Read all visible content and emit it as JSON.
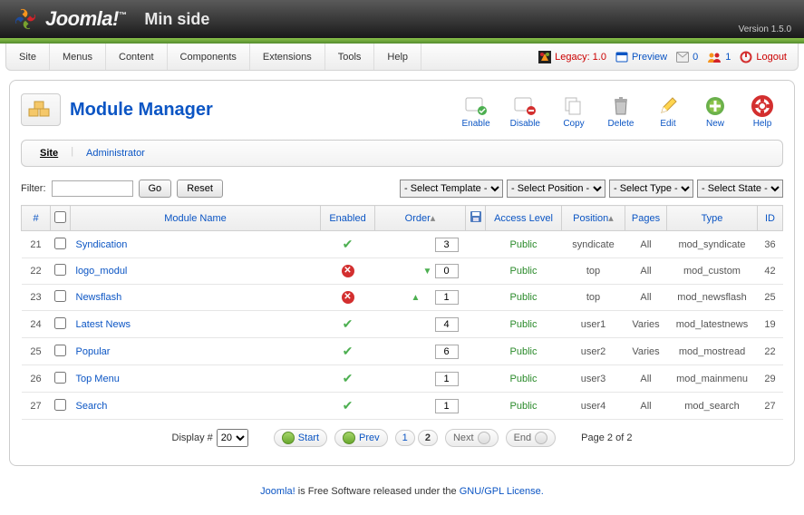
{
  "header": {
    "brand": "Joomla!",
    "site_name": "Min side",
    "version": "Version 1.5.0"
  },
  "menubar": {
    "items": [
      "Site",
      "Menus",
      "Content",
      "Components",
      "Extensions",
      "Tools",
      "Help"
    ],
    "legacy_label": "Legacy: 1.0",
    "preview_label": "Preview",
    "msg_count": "0",
    "users_count": "1",
    "logout_label": "Logout"
  },
  "page": {
    "title": "Module Manager",
    "submenu": {
      "site": "Site",
      "admin": "Administrator"
    }
  },
  "toolbar": {
    "enable": "Enable",
    "disable": "Disable",
    "copy": "Copy",
    "delete": "Delete",
    "edit": "Edit",
    "new": "New",
    "help": "Help"
  },
  "filter": {
    "label": "Filter:",
    "value": "",
    "go": "Go",
    "reset": "Reset",
    "selects": {
      "template": "- Select Template -",
      "position": "- Select Position -",
      "type": "- Select Type -",
      "state": "- Select State -"
    }
  },
  "columns": {
    "num": "#",
    "name": "Module Name",
    "enabled": "Enabled",
    "order": "Order",
    "access": "Access Level",
    "position": "Position",
    "pages": "Pages",
    "type": "Type",
    "id": "ID"
  },
  "rows": [
    {
      "num": "21",
      "name": "Syndication",
      "enabled": true,
      "up": false,
      "down": false,
      "order": "3",
      "access": "Public",
      "position": "syndicate",
      "pages": "All",
      "type": "mod_syndicate",
      "id": "36"
    },
    {
      "num": "22",
      "name": "logo_modul",
      "enabled": false,
      "up": false,
      "down": true,
      "order": "0",
      "access": "Public",
      "position": "top",
      "pages": "All",
      "type": "mod_custom",
      "id": "42"
    },
    {
      "num": "23",
      "name": "Newsflash",
      "enabled": false,
      "up": true,
      "down": false,
      "order": "1",
      "access": "Public",
      "position": "top",
      "pages": "All",
      "type": "mod_newsflash",
      "id": "25"
    },
    {
      "num": "24",
      "name": "Latest News",
      "enabled": true,
      "up": false,
      "down": false,
      "order": "4",
      "access": "Public",
      "position": "user1",
      "pages": "Varies",
      "type": "mod_latestnews",
      "id": "19"
    },
    {
      "num": "25",
      "name": "Popular",
      "enabled": true,
      "up": false,
      "down": false,
      "order": "6",
      "access": "Public",
      "position": "user2",
      "pages": "Varies",
      "type": "mod_mostread",
      "id": "22"
    },
    {
      "num": "26",
      "name": "Top Menu",
      "enabled": true,
      "up": false,
      "down": false,
      "order": "1",
      "access": "Public",
      "position": "user3",
      "pages": "All",
      "type": "mod_mainmenu",
      "id": "29"
    },
    {
      "num": "27",
      "name": "Search",
      "enabled": true,
      "up": false,
      "down": false,
      "order": "1",
      "access": "Public",
      "position": "user4",
      "pages": "All",
      "type": "mod_search",
      "id": "27"
    }
  ],
  "pagination": {
    "display_label": "Display #",
    "display_value": "20",
    "start": "Start",
    "prev": "Prev",
    "pages": [
      "1",
      "2"
    ],
    "current": "2",
    "next": "Next",
    "end": "End",
    "info": "Page 2 of 2"
  },
  "footer": {
    "pre": "Joomla!",
    "mid": " is Free Software released under the ",
    "link": "GNU/GPL License.",
    "post": ""
  }
}
